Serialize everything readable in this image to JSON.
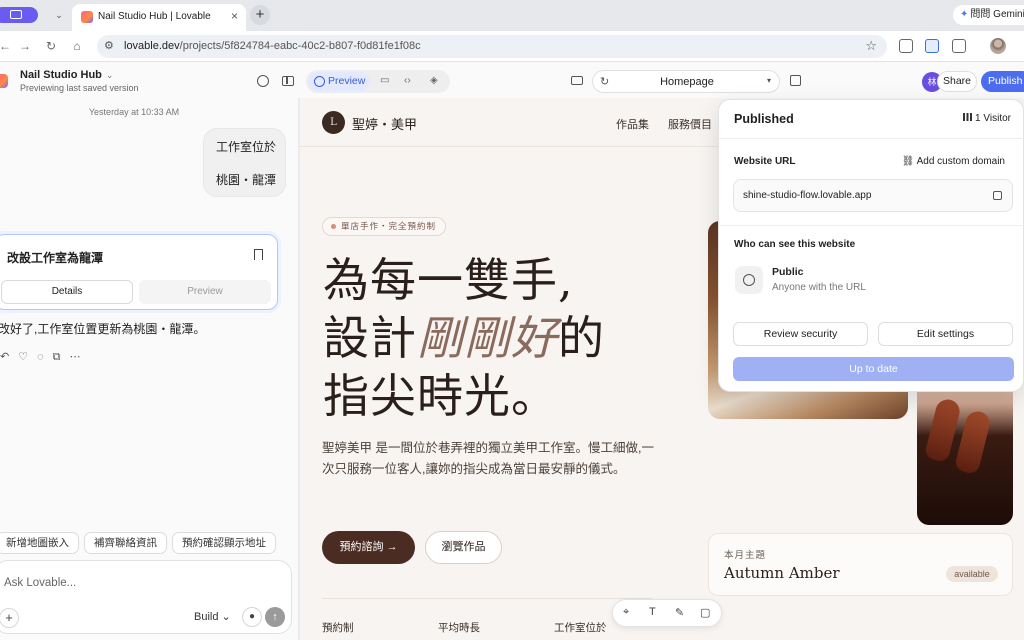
{
  "browser": {
    "tab_title": "Nail Studio Hub | Lovable",
    "tab_close": "×",
    "new_tab": "+",
    "gemini_label": "問問 Gemini",
    "url_host": "lovable.dev",
    "url_path": "/projects/5f824784-eabc-40c2-b807-f0d81fe1f08c"
  },
  "project": {
    "name": "Nail Studio Hub",
    "subtitle": "Previewing last saved version"
  },
  "chat": {
    "timestamp": "Yesterday at 10:33 AM",
    "user_message_lines": [
      "工作室位於",
      "桃園・龍潭"
    ],
    "card_title": "改設工作室為龍潭",
    "card_tabs": [
      "Details",
      "Preview"
    ],
    "reply": "改好了,工作室位置更新為桃園・龍潭。",
    "suggestions": [
      "新增地圖嵌入",
      "補齊聯絡資訊",
      "預約確認顯示地址"
    ],
    "input_placeholder": "Ask Lovable...",
    "mode_label": "Build"
  },
  "toolbar": {
    "preview_label": "Preview",
    "page_selector": "Homepage",
    "share_label": "Share",
    "publish_label": "Publish",
    "collaborator_initial": "林"
  },
  "site": {
    "logo_letter": "L",
    "brand": "聖婷・美甲",
    "nav": [
      "作品集",
      "服務價目"
    ],
    "pill": "單店手作・完全預約制",
    "headline_line1": "為每一雙手,",
    "headline_line2_pre": "設計",
    "headline_line2_italic": "剛剛好",
    "headline_line2_post": "的",
    "headline_line3": "指尖時光。",
    "description": "聖婷美甲 是一間位於巷弄裡的獨立美甲工作室。慢工細做,一次只服務一位客人,讓妳的指尖成為當日最安靜的儀式。",
    "cta_primary": "預約諮詢 →",
    "cta_secondary": "瀏覽作品",
    "stats": [
      "預約制",
      "平均時長",
      "工作室位於"
    ],
    "theme_label": "本月主題",
    "theme_name": "Autumn Amber",
    "theme_status": "available"
  },
  "publish_popover": {
    "title": "Published",
    "visitors": "1 Visitor",
    "website_url_label": "Website URL",
    "add_domain": "Add custom domain",
    "url": "shine-studio-flow.lovable.app",
    "visibility_label": "Who can see this website",
    "visibility_title": "Public",
    "visibility_sub": "Anyone with the URL",
    "review_security": "Review security",
    "edit_settings": "Edit settings",
    "status_button": "Up to date"
  },
  "colors": {
    "accent": "#4c6df0",
    "brand_dark": "#4a2c22",
    "publish_disabled": "#9fb0f5"
  }
}
